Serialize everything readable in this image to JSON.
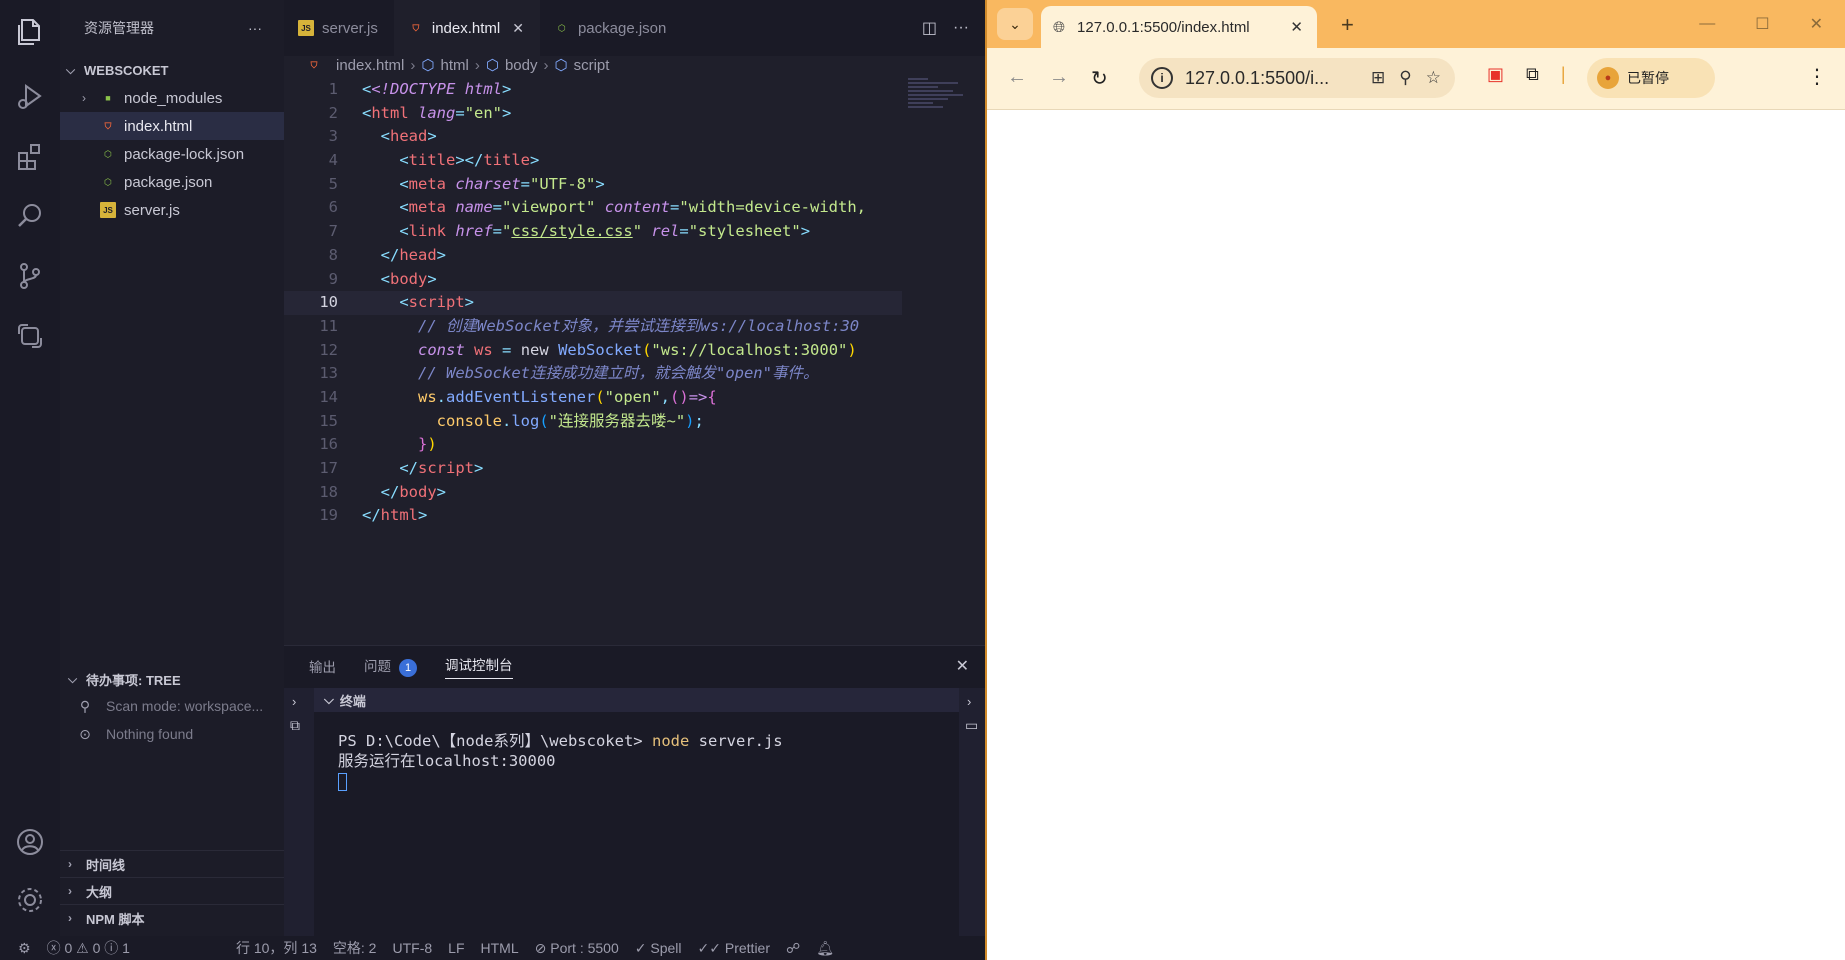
{
  "vscode": {
    "sidebar": {
      "title": "资源管理器",
      "more": "···",
      "folder": "WEBSCOKET",
      "files": [
        {
          "name": "node_modules",
          "type": "folder"
        },
        {
          "name": "index.html",
          "type": "html",
          "active": true
        },
        {
          "name": "package-lock.json",
          "type": "json"
        },
        {
          "name": "package.json",
          "type": "json"
        },
        {
          "name": "server.js",
          "type": "js"
        }
      ],
      "todo": {
        "title": "待办事项: TREE",
        "items": [
          "Scan mode: workspace...",
          "Nothing found"
        ]
      },
      "sections": [
        "时间线",
        "大纲",
        "NPM 脚本"
      ]
    },
    "tabs": [
      {
        "label": "server.js",
        "icon": "JS"
      },
      {
        "label": "index.html",
        "icon": "html5",
        "active": true
      },
      {
        "label": "package.json",
        "icon": "json"
      }
    ],
    "breadcrumb": [
      "index.html",
      "html",
      "body",
      "script"
    ],
    "code_lines": [
      "1",
      "2",
      "3",
      "4",
      "5",
      "6",
      "7",
      "8",
      "9",
      "10",
      "11",
      "12",
      "13",
      "14",
      "15",
      "16",
      "17",
      "18",
      "19"
    ],
    "code": {
      "l1_doctype": "<!DOCTYPE",
      "l1_html": "html",
      "l2_attr": "lang",
      "l2_val": "\"en\"",
      "l4_tag": "title",
      "l5_attr": "charset",
      "l5_val": "\"UTF-8\"",
      "l6_name": "name",
      "l6_nameval": "\"viewport\"",
      "l6_content": "content",
      "l6_contentval": "\"width=device-width,",
      "l7_href": "href",
      "l7_hrefval": "css/style.css",
      "l7_rel": "rel",
      "l7_relval": "\"stylesheet\"",
      "l11_comment": "// 创建WebSocket对象，并尝试连接到ws://localhost:30",
      "l12_const": "const",
      "l12_ws": "ws",
      "l12_new": "new",
      "l12_class": "WebSocket",
      "l12_str": "\"ws://localhost:3000\"",
      "l13_comment": "// WebSocket连接成功建立时，就会触发\"open\"事件。",
      "l14_ws": "ws",
      "l14_fn": "addEventListener",
      "l14_str": "\"open\"",
      "l15_console": "console",
      "l15_fn": "log",
      "l15_str": "\"连接服务器去喽~\""
    },
    "panel": {
      "tabs": [
        "输出",
        "问题",
        "调试控制台"
      ],
      "problems_count": "1",
      "terminal_title": "终端",
      "prompt": "PS D:\\Code\\【node系列】\\webscoket>",
      "command": "node",
      "command_arg": "server.js",
      "output": "服务运行在localhost:30000"
    },
    "statusbar": {
      "errors": "0",
      "warnings": "0",
      "infos": "1",
      "position": "行 10，列 13",
      "spaces": "空格: 2",
      "encoding": "UTF-8",
      "eol": "LF",
      "language": "HTML",
      "port": "Port : 5500",
      "spell": "Spell",
      "prettier": "Prettier"
    }
  },
  "browser": {
    "tab_title": "127.0.0.1:5500/index.html",
    "url": "127.0.0.1:5500/i...",
    "pause_label": "已暂停"
  }
}
